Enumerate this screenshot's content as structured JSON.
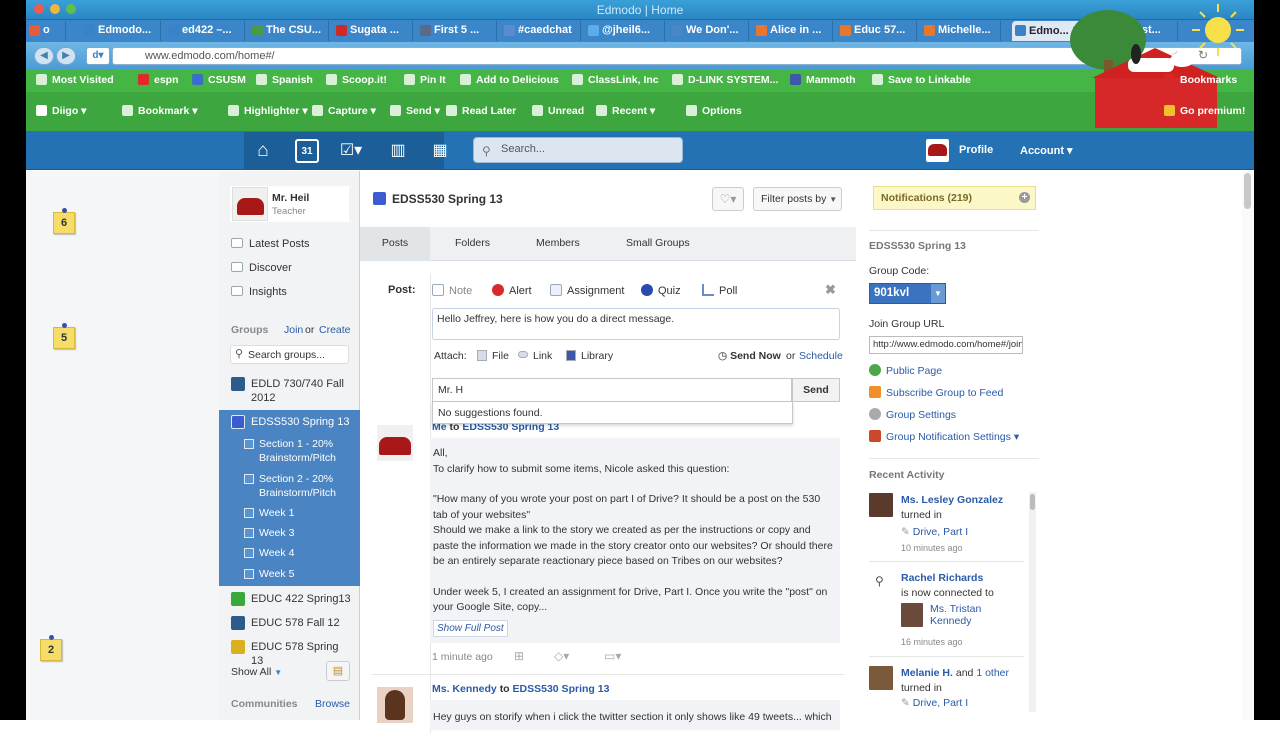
{
  "window": {
    "title": "Edmodo | Home"
  },
  "tabs": [
    {
      "label": "o",
      "color": "#e85a3a"
    },
    {
      "label": "Edmodo...",
      "color": "#3a82c8"
    },
    {
      "label": "ed422 –...",
      "color": "#3a82c8"
    },
    {
      "label": "The CSU...",
      "color": "#4a9a4a"
    },
    {
      "label": "Sugata ...",
      "color": "#d02828"
    },
    {
      "label": "First 5 ...",
      "color": "#5a6a8a"
    },
    {
      "label": "#caedchat",
      "color": "#5a8ad0"
    },
    {
      "label": "@jheil6...",
      "color": "#5aaee8"
    },
    {
      "label": "We Don'...",
      "color": "#4a86c8"
    },
    {
      "label": "Alice in ...",
      "color": "#e8772e"
    },
    {
      "label": "Educ 57...",
      "color": "#e8772e"
    },
    {
      "label": "Michelle...",
      "color": "#e8772e"
    },
    {
      "label": "Edmo...",
      "color": "#3a82c8"
    },
    {
      "label": "K-12 st...",
      "color": "#888888"
    }
  ],
  "url": "www.edmodo.com/home#/",
  "bookmarks_row1": [
    "Most Visited",
    "espn",
    "CSUSM",
    "Spanish",
    "Scoop.it!",
    "Pin It",
    "Add to Delicious",
    "ClassLink, Inc",
    "D-LINK SYSTEM...",
    "Mammoth",
    "Save to Linkable"
  ],
  "bookmarks_right": "Bookmarks",
  "bookmarks_row2": [
    "Diigo",
    "Bookmark",
    "Highlighter",
    "Capture",
    "Send",
    "Read Later",
    "Unread",
    "Recent",
    "Options"
  ],
  "go_premium": "Go premium!",
  "appbar": {
    "calendar_day": "31",
    "search_placeholder": "Search...",
    "profile": "Profile",
    "account": "Account ▾"
  },
  "stickies": [
    "6",
    "5",
    "2"
  ],
  "user": {
    "name": "Mr. Heil",
    "role": "Teacher"
  },
  "leftnav": {
    "items": [
      "Latest Posts",
      "Discover",
      "Insights"
    ],
    "groups_label": "Groups",
    "join": "Join",
    "or": "or",
    "create": "Create",
    "search_placeholder": "Search groups...",
    "groups": [
      {
        "label": "EDLD 730/740 Fall 2012",
        "color": "#2e5c8a"
      },
      {
        "label": "EDSS530 Spring 13",
        "color": "#3c5bd0"
      },
      {
        "label": "EDUC 422 Spring13",
        "color": "#3ca83c"
      },
      {
        "label": "EDUC 578 Fall 12",
        "color": "#2e5c8a"
      },
      {
        "label": "EDUC 578 Spring 13",
        "color": "#d8b020"
      }
    ],
    "subgroups": [
      "Section 1 - 20% Brainstorm/Pitch",
      "Section 2 - 20% Brainstorm/Pitch",
      "Week 1",
      "Week 3",
      "Week 4",
      "Week 5"
    ],
    "show_all": "Show All",
    "communities": "Communities",
    "browse": "Browse"
  },
  "main": {
    "title": "EDSS530 Spring 13",
    "filter": "Filter posts by",
    "tabs": [
      "Posts",
      "Folders",
      "Members",
      "Small Groups"
    ],
    "post_label": "Post:",
    "post_types": [
      "Note",
      "Alert",
      "Assignment",
      "Quiz",
      "Poll"
    ],
    "message": "Hello Jeffrey, here is how you do a direct message.",
    "attach_label": "Attach:",
    "attach": [
      "File",
      "Link",
      "Library"
    ],
    "send_now": "Send Now",
    "or": "or",
    "schedule": "Schedule",
    "recipient": "Mr. H",
    "send": "Send",
    "no_suggestions": "No suggestions found.",
    "post1": {
      "author": "Me",
      "to": "to",
      "group": "EDSS530 Spring 13",
      "para1": "All,",
      "para1b": "To clarify how to submit some items, Nicole asked this question:",
      "para2": "\"How many of you wrote your post on part I of Drive? It should be a post on the 530 tab of your websites\"",
      "para3": "Should we make a link to the story we created as per the instructions or copy and paste the information we made in the story creator onto our websites? Or should there be an entirely separate reactionary piece based on Tribes on our websites?",
      "para4": "Under week 5, I created an assignment for Drive, Part I. Once you write the \"post\" on your Google Site, copy...",
      "show_full": "Show Full Post",
      "time": "1 minute ago"
    },
    "post2": {
      "author": "Ms. Kennedy",
      "to": "to",
      "group": "EDSS530 Spring 13",
      "body": "Hey guys on storify when i click the twitter section it only shows like 49 tweets... which"
    }
  },
  "right": {
    "notifications": "Notifications (219)",
    "group_title": "EDSS530 Spring 13",
    "group_code_label": "Group Code:",
    "group_code": "901kvl",
    "join_url_label": "Join Group URL",
    "join_url": "http://www.edmodo.com/home#/join",
    "links": [
      "Public Page",
      "Subscribe Group to Feed",
      "Group Settings",
      "Group Notification Settings ▾"
    ],
    "recent_activity": "Recent Activity",
    "activity": [
      {
        "name": "Ms. Lesley Gonzalez",
        "text": "turned in",
        "item": "Drive, Part I",
        "time": "10 minutes ago"
      },
      {
        "name": "Rachel Richards",
        "text": "is now connected to",
        "item": "Ms. Tristan Kennedy",
        "time": "16 minutes ago"
      },
      {
        "name": "Melanie H.",
        "text_and": "and",
        "other": "1 other",
        "text": "turned in",
        "item": "Drive, Part I"
      }
    ]
  }
}
